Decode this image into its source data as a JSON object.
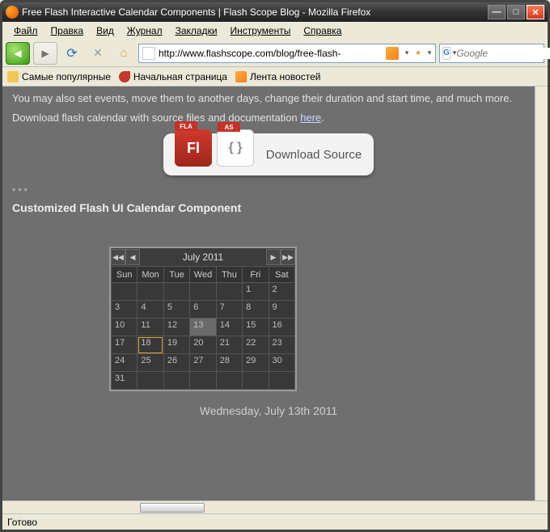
{
  "window": {
    "title": "Free Flash Interactive Calendar Components | Flash Scope Blog - Mozilla Firefox"
  },
  "menu": {
    "file": "Файл",
    "edit": "Правка",
    "view": "Вид",
    "history": "Журнал",
    "bookmarks": "Закладки",
    "tools": "Инструменты",
    "help": "Справка"
  },
  "toolbar": {
    "url": "http://www.flashscope.com/blog/free-flash-",
    "search_placeholder": "Google"
  },
  "bookmarks": {
    "popular": "Самые популярные",
    "home": "Начальная страница",
    "feeds": "Лента новостей"
  },
  "page": {
    "line1": "You may also set events, move them to another days, change their duration and start time, and much more.",
    "line2a": "Download flash calendar with source files and documentation ",
    "line2b": "here",
    "line2c": ".",
    "download_label": "Download Source",
    "fla_tag": "FLA",
    "fla_body": "Fl",
    "as_tag": "AS",
    "as_body": "{ }",
    "stars": "* * *",
    "subheading": "Customized Flash UI Calendar Component",
    "date_text": "Wednesday, July 13th 2011"
  },
  "calendar": {
    "title": "July  2011",
    "dow": [
      "Sun",
      "Mon",
      "Tue",
      "Wed",
      "Thu",
      "Fri",
      "Sat"
    ],
    "weeks": [
      [
        "",
        "",
        "",
        "",
        "",
        "1",
        "2"
      ],
      [
        "3",
        "4",
        "5",
        "6",
        "7",
        "8",
        "9"
      ],
      [
        "10",
        "11",
        "12",
        "13",
        "14",
        "15",
        "16"
      ],
      [
        "17",
        "18",
        "19",
        "20",
        "21",
        "22",
        "23"
      ],
      [
        "24",
        "25",
        "26",
        "27",
        "28",
        "29",
        "30"
      ],
      [
        "31",
        "",
        "",
        "",
        "",
        "",
        ""
      ]
    ],
    "selected": "13",
    "today": "18"
  },
  "status": {
    "text": "Готово"
  }
}
